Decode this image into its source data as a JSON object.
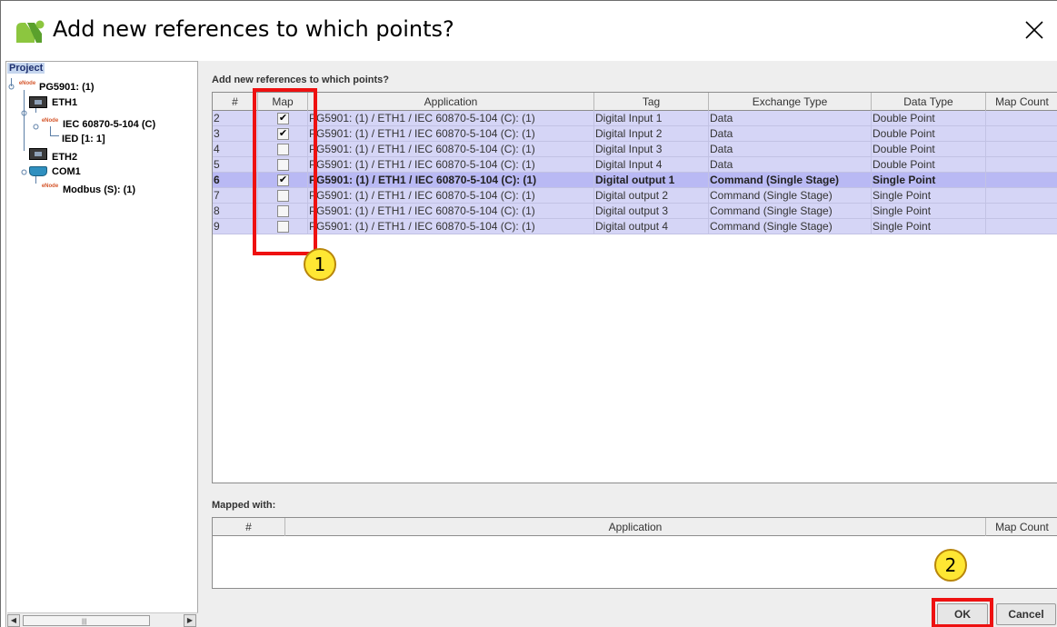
{
  "window": {
    "title": "Add new references to which points?"
  },
  "tree": {
    "root_label": "Project",
    "nodes": [
      {
        "label": "PG5901: (1)",
        "icon": "enode-icon"
      },
      {
        "label": "ETH1",
        "icon": "ethernet-port-icon"
      },
      {
        "label": "IEC 60870-5-104  (C)",
        "icon": "enode-icon"
      },
      {
        "label": "IED [1: 1]",
        "icon": ""
      },
      {
        "label": "ETH2",
        "icon": "ethernet-port-icon"
      },
      {
        "label": "COM1",
        "icon": "serial-port-icon"
      },
      {
        "label": "Modbus (S): (1)",
        "icon": "enode-icon"
      }
    ],
    "icon_text": "eNode"
  },
  "points_section": {
    "label": "Add new references to which points?",
    "columns": [
      "#",
      "Map",
      "Application",
      "Tag",
      "Exchange Type",
      "Data Type",
      "Map Count"
    ],
    "rows": [
      {
        "num": "2",
        "mapped": true,
        "application": "PG5901: (1) / ETH1 / IEC 60870-5-104  (C): (1)",
        "tag": "Digital Input 1",
        "exchange": "Data",
        "datatype": "Double Point",
        "count": "",
        "selected": false
      },
      {
        "num": "3",
        "mapped": true,
        "application": "PG5901: (1) / ETH1 / IEC 60870-5-104  (C): (1)",
        "tag": "Digital Input 2",
        "exchange": "Data",
        "datatype": "Double Point",
        "count": "",
        "selected": false
      },
      {
        "num": "4",
        "mapped": false,
        "application": "PG5901: (1) / ETH1 / IEC 60870-5-104  (C): (1)",
        "tag": "Digital Input 3",
        "exchange": "Data",
        "datatype": "Double Point",
        "count": "",
        "selected": false
      },
      {
        "num": "5",
        "mapped": false,
        "application": "PG5901: (1) / ETH1 / IEC 60870-5-104  (C): (1)",
        "tag": "Digital Input 4",
        "exchange": "Data",
        "datatype": "Double Point",
        "count": "",
        "selected": false
      },
      {
        "num": "6",
        "mapped": true,
        "application": "PG5901: (1) / ETH1 / IEC 60870-5-104  (C): (1)",
        "tag": "Digital output 1",
        "exchange": "Command (Single Stage)",
        "datatype": "Single Point",
        "count": "",
        "selected": true
      },
      {
        "num": "7",
        "mapped": false,
        "application": "PG5901: (1) / ETH1 / IEC 60870-5-104  (C): (1)",
        "tag": "Digital output 2",
        "exchange": "Command (Single Stage)",
        "datatype": "Single Point",
        "count": "",
        "selected": false
      },
      {
        "num": "8",
        "mapped": false,
        "application": "PG5901: (1) / ETH1 / IEC 60870-5-104  (C): (1)",
        "tag": "Digital output 3",
        "exchange": "Command (Single Stage)",
        "datatype": "Single Point",
        "count": "",
        "selected": false
      },
      {
        "num": "9",
        "mapped": false,
        "application": "PG5901: (1) / ETH1 / IEC 60870-5-104  (C): (1)",
        "tag": "Digital output 4",
        "exchange": "Command (Single Stage)",
        "datatype": "Single Point",
        "count": "",
        "selected": false
      }
    ],
    "check_glyph": "✔"
  },
  "mapped_section": {
    "label": "Mapped with:",
    "columns": [
      "#",
      "Application",
      "Map Count"
    ]
  },
  "buttons": {
    "ok": "OK",
    "cancel": "Cancel"
  },
  "annotations": {
    "step1": "1",
    "step2": "2"
  },
  "colors": {
    "row_bg": "#d5d5f6",
    "row_selected_bg": "#b9b9f4",
    "annotation_red": "#ee1111",
    "annotation_yellow": "#ffe733"
  }
}
